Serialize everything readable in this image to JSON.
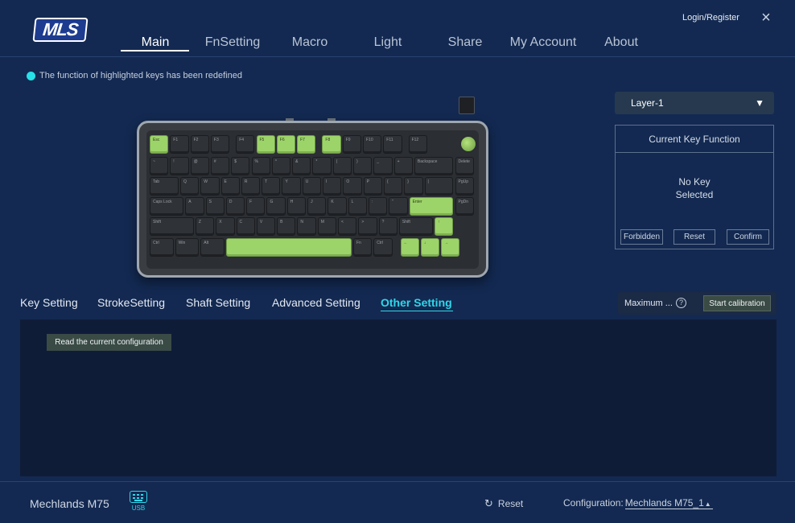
{
  "app": {
    "logo_text": "MLS",
    "login_label": "Login/Register",
    "close_icon": "×"
  },
  "nav": {
    "items": [
      {
        "label": "Main"
      },
      {
        "label": "FnSetting"
      },
      {
        "label": "Macro"
      },
      {
        "label": "Light"
      },
      {
        "label": "Share"
      },
      {
        "label": "My Account"
      },
      {
        "label": "About"
      }
    ],
    "active": "Main"
  },
  "notice": {
    "text": "The function of highlighted keys has been redefined",
    "dot_color": "#28e0e8"
  },
  "layer_select": {
    "value": "Layer-1",
    "caret": "▼"
  },
  "current_key": {
    "title": "Current Key Function",
    "empty_line1": "No Key",
    "empty_line2": "Selected",
    "buttons": {
      "forbidden": "Forbidden",
      "reset": "Reset",
      "confirm": "Confirm"
    }
  },
  "tabs": {
    "items": [
      {
        "label": "Key Setting"
      },
      {
        "label": "StrokeSetting"
      },
      {
        "label": "Shaft Setting"
      },
      {
        "label": "Advanced Setting"
      },
      {
        "label": "Other Setting"
      }
    ],
    "active": "Other Setting"
  },
  "calibration": {
    "label": "Maximum ...",
    "help_icon": "?",
    "button": "Start calibration"
  },
  "other_setting": {
    "read_button": "Read the current configuration"
  },
  "footer": {
    "device_name": "Mechlands M75",
    "connection": "USB",
    "reset_label": "Reset",
    "reset_icon": "↻",
    "config_label": "Configuration:",
    "config_value": "Mechlands M75_1",
    "config_caret": "▲"
  },
  "colors": {
    "accent": "#2ed7ea",
    "background": "#132951",
    "key_green": "#9dd46a"
  },
  "keyboard": {
    "rows": [
      [
        "Esc",
        "F1",
        "F2",
        "F3",
        "F4",
        "F5",
        "F6",
        "F7",
        "F8",
        "F9",
        "F10",
        "F11",
        "F12"
      ],
      [
        "~",
        "!",
        "@",
        "#",
        "$",
        "%",
        "^",
        "&",
        "*",
        "(",
        ")",
        "_",
        "+",
        "Backspace",
        "Delete"
      ],
      [
        "Tab",
        "Q",
        "W",
        "E",
        "R",
        "T",
        "Y",
        "U",
        "I",
        "O",
        "P",
        "{",
        "}",
        "|",
        "PgUp"
      ],
      [
        "Caps Lock",
        "A",
        "S",
        "D",
        "F",
        "G",
        "H",
        "J",
        "K",
        "L",
        ":",
        "\"",
        "Enter",
        "PgDn"
      ],
      [
        "Shift",
        "Z",
        "X",
        "C",
        "V",
        "B",
        "N",
        "M",
        "<",
        ">",
        "?",
        "Shift",
        "↑"
      ],
      [
        "Ctrl",
        "Win",
        "Alt",
        "",
        "Fn",
        "Ctrl",
        "←",
        "↓",
        "→"
      ]
    ]
  }
}
